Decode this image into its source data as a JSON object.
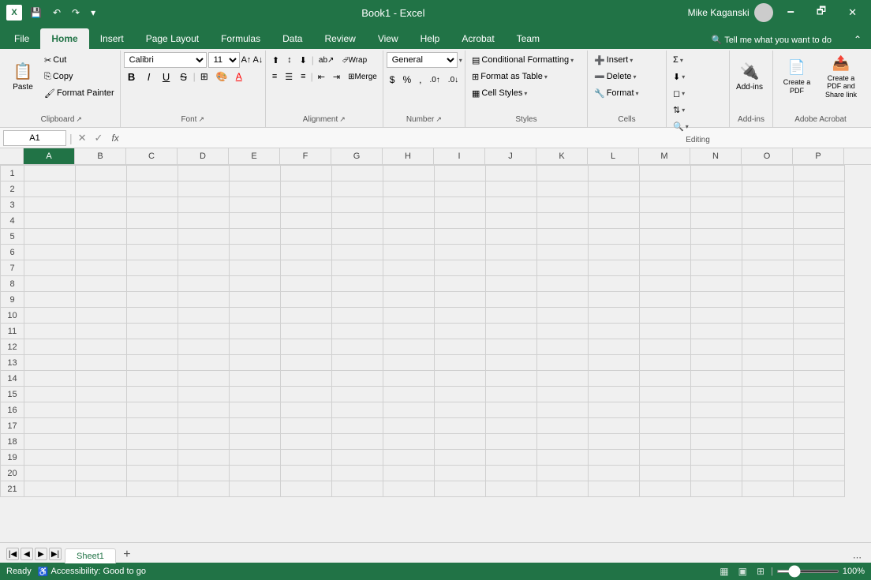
{
  "titlebar": {
    "app_name": "Book1 - Excel",
    "user_name": "Mike Kaganski",
    "save_label": "💾",
    "undo_label": "↶",
    "redo_label": "↷",
    "minimize": "🗕",
    "restore": "🗗",
    "close": "✕"
  },
  "ribbon_tabs": [
    {
      "id": "file",
      "label": "File",
      "active": false
    },
    {
      "id": "home",
      "label": "Home",
      "active": true
    },
    {
      "id": "insert",
      "label": "Insert",
      "active": false
    },
    {
      "id": "page_layout",
      "label": "Page Layout",
      "active": false
    },
    {
      "id": "formulas",
      "label": "Formulas",
      "active": false
    },
    {
      "id": "data",
      "label": "Data",
      "active": false
    },
    {
      "id": "review",
      "label": "Review",
      "active": false
    },
    {
      "id": "view",
      "label": "View",
      "active": false
    },
    {
      "id": "help",
      "label": "Help",
      "active": false
    },
    {
      "id": "acrobat",
      "label": "Acrobat",
      "active": false
    },
    {
      "id": "team",
      "label": "Team",
      "active": false
    }
  ],
  "ribbon_extra": {
    "search_label": "🔍 Tell me what you want to do",
    "share_label": "🔗",
    "collapse_label": "⌃"
  },
  "groups": {
    "clipboard": {
      "label": "Clipboard",
      "paste_label": "Paste",
      "cut_label": "Cut",
      "copy_label": "Copy",
      "format_painter_label": "Format Painter"
    },
    "font": {
      "label": "Font",
      "font_name": "Calibri",
      "font_size": "11",
      "bold_label": "B",
      "italic_label": "I",
      "underline_label": "U",
      "strikethrough_label": "S",
      "increase_font_label": "A↑",
      "decrease_font_label": "A↓",
      "font_color_label": "A",
      "fill_color_label": "A"
    },
    "alignment": {
      "label": "Alignment",
      "align_top_label": "≡↑",
      "align_middle_label": "≡",
      "align_bottom_label": "≡↓",
      "align_left_label": "≡",
      "align_center_label": "≡",
      "align_right_label": "≡",
      "wrap_text_label": "⮰",
      "merge_label": "⊞",
      "indent_decrease_label": "⇤",
      "indent_increase_label": "⇥",
      "orientation_label": "abc"
    },
    "number": {
      "label": "Number",
      "format_label": "General",
      "percent_label": "%",
      "comma_label": ",",
      "currency_label": "$",
      "increase_decimal_label": ".0→",
      "decrease_decimal_label": "←.0"
    },
    "styles": {
      "label": "Styles",
      "conditional_formatting_label": "Conditional Formatting",
      "format_table_label": "Format as Table",
      "cell_styles_label": "Cell Styles"
    },
    "cells": {
      "label": "Cells",
      "insert_label": "Insert",
      "delete_label": "Delete",
      "format_label": "Format"
    },
    "editing": {
      "label": "Editing",
      "sum_label": "Σ",
      "fill_label": "⬇",
      "clear_label": "◻",
      "sort_filter_label": "⇅",
      "find_select_label": "🔍"
    },
    "addins": {
      "label": "Add-ins",
      "addins_btn_label": "Add-ins"
    },
    "adobe_acrobat": {
      "label": "Adobe Acrobat",
      "create_pdf_label": "Create a PDF",
      "create_pdf_share_label": "Create a PDF and Share link"
    }
  },
  "formula_bar": {
    "cell_ref": "A1",
    "formula_content": "",
    "fx_label": "fx"
  },
  "grid": {
    "columns": [
      "A",
      "B",
      "C",
      "D",
      "E",
      "F",
      "G",
      "H",
      "I",
      "J",
      "K",
      "L",
      "M",
      "N",
      "O",
      "P"
    ],
    "row_count": 21,
    "selected_cell": "A1"
  },
  "sheet_tabs": [
    {
      "id": "sheet1",
      "label": "Sheet1",
      "active": true
    }
  ],
  "status_bar": {
    "ready_label": "Ready",
    "accessibility_label": "Accessibility: Good to go",
    "zoom_level": "100%",
    "normal_view_label": "▦",
    "page_layout_label": "▣",
    "page_break_label": "⊞"
  }
}
